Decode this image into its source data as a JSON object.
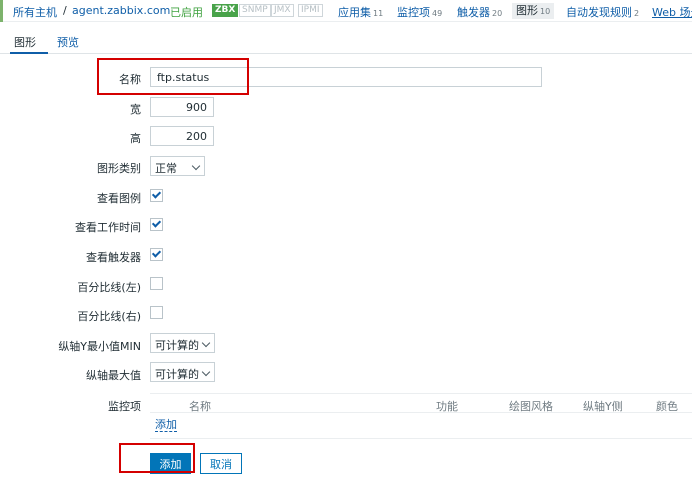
{
  "breadcrumb": {
    "all_hosts": "所有主机",
    "separator": "/",
    "host": "agent.zabbix.com",
    "status": "已启用",
    "availability": [
      "ZBX",
      "SNMP",
      "JMX",
      "IPMI"
    ],
    "nav": [
      {
        "label": "应用集",
        "count": "11"
      },
      {
        "label": "监控项",
        "count": "49"
      },
      {
        "label": "触发器",
        "count": "20"
      },
      {
        "label": "图形",
        "count": "10"
      },
      {
        "label": "自动发现规则",
        "count": "2"
      },
      {
        "label": "Web 场景",
        "count": ""
      }
    ]
  },
  "tabs": [
    "图形",
    "预览"
  ],
  "form": {
    "name_label": "名称",
    "name_value": "ftp.status",
    "width_label": "宽",
    "width_value": "900",
    "height_label": "高",
    "height_value": "200",
    "graph_type_label": "图形类别",
    "graph_type_value": "正常",
    "show_legend_label": "查看图例",
    "show_working_time_label": "查看工作时间",
    "show_triggers_label": "查看触发器",
    "percentile_left_label": "百分比线(左)",
    "percentile_right_label": "百分比线(右)",
    "ymin_label": "纵轴Y最小值MIN",
    "ymin_value": "可计算的",
    "ymax_label": "纵轴最大值",
    "ymax_value": "可计算的",
    "items_label": "监控项",
    "items_columns": [
      "名称",
      "功能",
      "绘图风格",
      "纵轴Y侧",
      "颜色"
    ],
    "add_item_link": "添加"
  },
  "buttons": {
    "add": "添加",
    "cancel": "取消"
  },
  "colors": {
    "link": "#0f5ea8",
    "primary": "#0275b8",
    "enabled": "#3fa23f",
    "zbx_badge": "#49a34a",
    "highlight": "#d40000"
  }
}
